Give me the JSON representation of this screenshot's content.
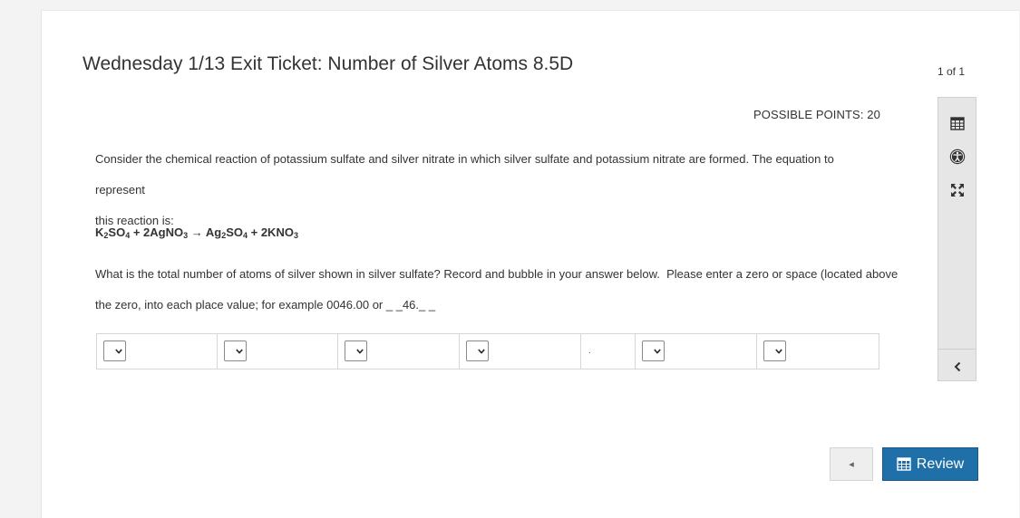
{
  "header": {
    "title": "Wednesday 1/13 Exit Ticket: Number of Silver Atoms 8.5D",
    "page_count": "1 of 1"
  },
  "question": {
    "points_label": "POSSIBLE POINTS: 20",
    "intro_line1": "Consider the chemical reaction of potassium sulfate and silver nitrate in which silver sulfate and potassium nitrate are formed. The equation to represent",
    "intro_line2": "this reaction is:",
    "equation": {
      "t1": "K",
      "s1": "2",
      "t2": "SO",
      "s2": "4",
      "t3": " + 2AgNO",
      "s3": "3",
      "t4": " → Ag",
      "s4": "2",
      "t5": "SO",
      "s5": "4",
      "t6": " + 2KNO",
      "s6": "3"
    },
    "prompt_line1": "What is the total number of atoms of silver shown in silver sulfate? Record and bubble in your answer below.  Please enter a zero or space (located above",
    "prompt_line2": "the zero, into each place value; for example 0046.00 or _ _46._ _",
    "decimal_point": "."
  },
  "answer_grid": {
    "selected_values": [
      "",
      "",
      "",
      "",
      "",
      ""
    ]
  },
  "toolbar": {
    "tools": [
      "calendar-icon",
      "accessibility-icon",
      "expand-icon",
      "chevron-left-icon"
    ]
  },
  "footer": {
    "prev_symbol": "◂",
    "review_label": "Review"
  },
  "colors": {
    "accent": "#1f6fa8",
    "toolbar_bg": "#e6e6e6"
  }
}
